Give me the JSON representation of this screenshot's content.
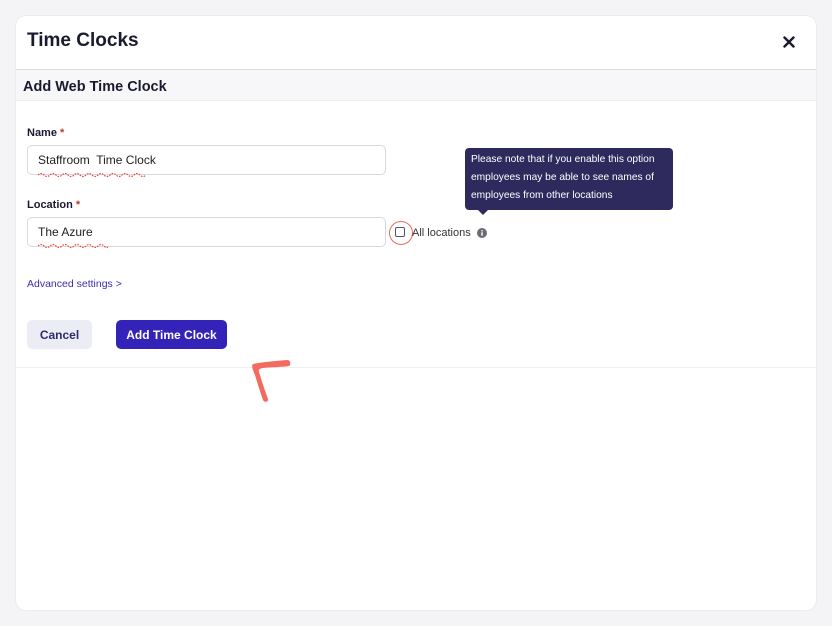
{
  "modal": {
    "title": "Time Clocks",
    "close_icon": "close-icon"
  },
  "section": {
    "title": "Add Web Time Clock"
  },
  "form": {
    "name": {
      "label": "Name",
      "required_marker": "*",
      "value": "Staffroom  Time Clock"
    },
    "location": {
      "label": "Location",
      "required_marker": "*",
      "value": "The Azure"
    },
    "all_locations": {
      "label": "All locations",
      "checked": false,
      "info_icon": "info-icon"
    },
    "tooltip": {
      "text": "Please note that if you enable this option employees may be able to see names of employees from other locations"
    },
    "advanced_settings": "Advanced settings >"
  },
  "actions": {
    "cancel_label": "Cancel",
    "submit_label": "Add Time Clock"
  },
  "colors": {
    "primary": "#3323b8",
    "tooltip_bg": "#2e2a5e",
    "required": "#c0392b",
    "annotation": "#f26b5e",
    "spellcheck": "#e8453c"
  }
}
